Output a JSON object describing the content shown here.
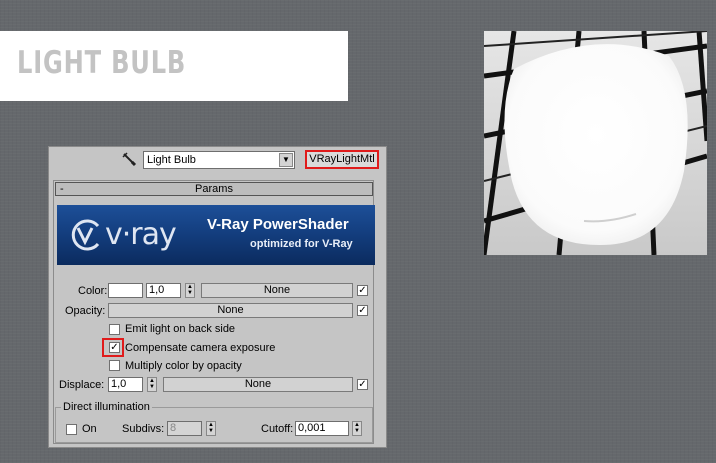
{
  "slide": {
    "title": "LIGHT BULB"
  },
  "panel": {
    "material_name": "Light Bulb",
    "material_type_button": "VRayLightMtl",
    "rollout": {
      "toggle": "-",
      "title": "Params"
    },
    "banner": {
      "brand": "v·ray",
      "title": "V-Ray PowerShader",
      "subtitle": "optimized for V-Ray"
    },
    "color": {
      "label": "Color:",
      "multiplier": "1,0",
      "map": "None",
      "map_enabled": "✓"
    },
    "opacity": {
      "label": "Opacity:",
      "map": "None",
      "map_enabled": "✓"
    },
    "options": [
      {
        "label": "Emit light on back side",
        "checked": ""
      },
      {
        "label": "Compensate camera exposure",
        "checked": "✓"
      },
      {
        "label": "Multiply color by opacity",
        "checked": ""
      }
    ],
    "displace": {
      "label": "Displace:",
      "amount": "1,0",
      "map": "None",
      "map_enabled": "✓"
    },
    "direct_illumination": {
      "group_label": "Direct illumination",
      "on_label": "On",
      "on_checked": "",
      "subdivs_label": "Subdivs:",
      "subdivs_value": "8",
      "cutoff_label": "Cutoff:",
      "cutoff_value": "0,001"
    }
  },
  "colors": {
    "highlight": "#e01b1b",
    "banner_blue": "#1d4f98",
    "panel_gray": "#c5c5c5"
  }
}
